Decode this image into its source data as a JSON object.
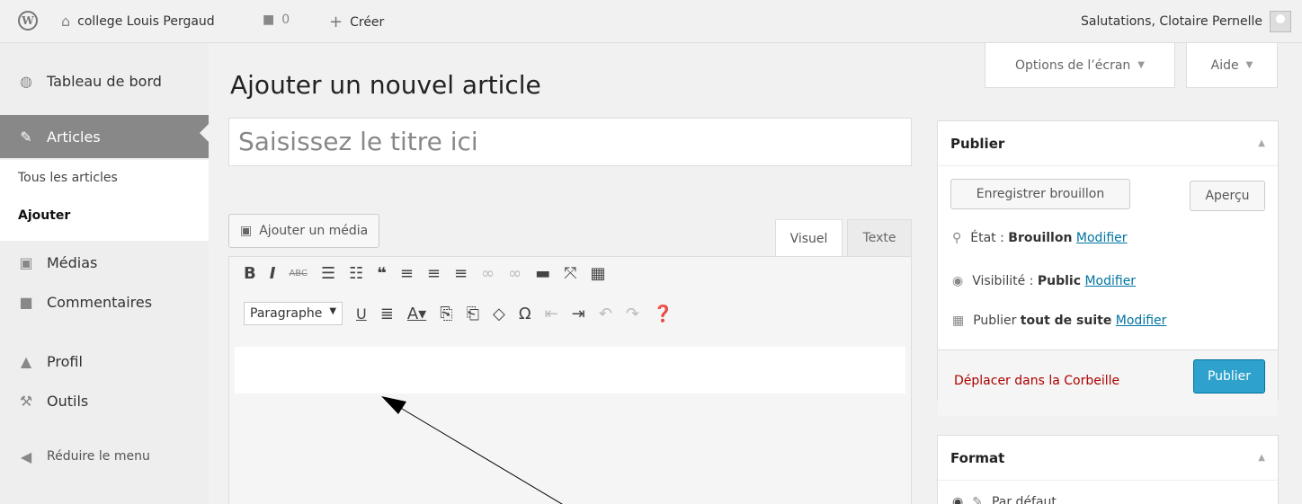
{
  "adminbar": {
    "site_name": "college Louis Pergaud",
    "comments_count": "0",
    "create_label": "Créer",
    "greeting": "Salutations, Clotaire Pernelle"
  },
  "menu": {
    "dashboard": "Tableau de bord",
    "articles": "Articles",
    "all_articles": "Tous les articles",
    "add": "Ajouter",
    "media": "Médias",
    "comments": "Commentaires",
    "profile": "Profil",
    "tools": "Outils",
    "collapse": "Réduire le menu"
  },
  "screen_tabs": {
    "options": "Options de l’écran",
    "help": "Aide"
  },
  "main": {
    "page_title": "Ajouter un nouvel article",
    "title_placeholder": "Saisissez le titre ici",
    "add_media": "Ajouter un média",
    "tab_visual": "Visuel",
    "tab_text": "Texte",
    "format_select": "Paragraphe"
  },
  "publish_box": {
    "title": "Publier",
    "save_draft": "Enregistrer brouillon",
    "preview": "Aperçu",
    "status_label": "État :",
    "status_value": "Brouillon",
    "visibility_label": "Visibilité :",
    "visibility_value": "Public",
    "publish_label": "Publier",
    "publish_value": "tout de suite",
    "modify": "Modifier",
    "trash": "Déplacer dans la Corbeille",
    "publish_button": "Publier"
  },
  "format_box": {
    "title": "Format",
    "first_option": "Par défaut"
  },
  "colors": {
    "primary": "#2ea2cc",
    "active_menu": "#888888",
    "trash": "#aa0000",
    "link": "#0074a2"
  }
}
